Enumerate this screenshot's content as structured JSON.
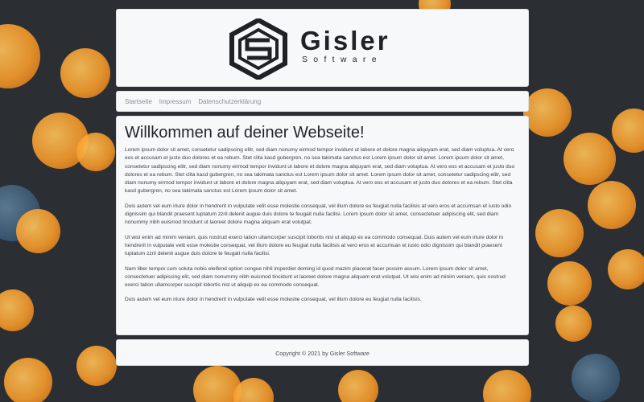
{
  "brand": {
    "name": "Gisler",
    "tagline": "Software",
    "color": "#1f2124"
  },
  "nav": {
    "items": [
      {
        "label": "Startseite"
      },
      {
        "label": "Impressum"
      },
      {
        "label": "Datenschutzerklärung"
      }
    ]
  },
  "main": {
    "title": "Willkommen auf deiner Webseite!",
    "paragraphs": [
      "Lorem ipsum dolor sit amet, consetetur sadipscing elitr, sed diam nonumy eirmod tempor invidunt ut labore et dolore magna aliquyam erat, sed diam voluptua. At vero eos et accusam et justo duo dolores et ea rebum. Stet clita kasd gubergren, no sea takimata sanctus est Lorem ipsum dolor sit amet. Lorem ipsum dolor sit amet, consetetur sadipscing elitr, sed diam nonumy eirmod tempor invidunt ut labore et dolore magna aliquyam erat, sed diam voluptua. At vero eos et accusam et justo duo dolores et ea rebum. Stet clita kasd gubergren, no sea takimata sanctus est Lorem ipsum dolor sit amet. Lorem ipsum dolor sit amet, consetetur sadipscing elitr, sed diam nonumy eirmod tempor invidunt ut labore et dolore magna aliquyam erat, sed diam voluptua. At vero eos et accusam et justo duo dolores et ea rebum. Stet clita kasd gubergren, no sea takimata sanctus est Lorem ipsum dolor sit amet.",
      "Duis autem vel eum iriure dolor in hendrerit in vulputate velit esse molestie consequat, vel illum dolore eu feugiat nulla facilisis at vero eros et accumsan et iusto odio dignissim qui blandit praesent luptatum zzril delenit augue duis dolore te feugait nulla facilisi. Lorem ipsum dolor sit amet, consectetuer adipiscing elit, sed diam nonummy nibh euismod tincidunt ut laoreet dolore magna aliquam erat volutpat.",
      "Ut wisi enim ad minim veniam, quis nostrud exerci tation ullamcorper suscipit lobortis nisl ut aliquip ex ea commodo consequat. Duis autem vel eum iriure dolor in hendrerit in vulputate velit esse molestie consequat, vel illum dolore eu feugiat nulla facilisis at vero eros et accumsan et iusto odio dignissim qui blandit praesent luptatum zzril delenit augue duis dolore te feugait nulla facilisi.",
      "Nam liber tempor cum soluta nobis eleifend option congue nihil imperdiet doming id quod mazim placerat facer possim assum. Lorem ipsum dolor sit amet, consectetuer adipiscing elit, sed diam nonummy nibh euismod tincidunt ut laoreet dolore magna aliquam erat volutpat. Ut wisi enim ad minim veniam, quis nostrud exerci tation ullamcorper suscipit lobortis nisl ut aliquip ex ea commodo consequat.",
      "Duis autem vel eum iriure dolor in hendrerit in vulputate velit esse molestie consequat, vel illum dolore eu feugiat nulla facilisis."
    ]
  },
  "footer": {
    "text": "Copyright © 2021 by Gisler Software"
  },
  "colors": {
    "card_bg": "#f7f8f9",
    "bokeh_orange": "#f59a2a",
    "background": "#2b2f34"
  }
}
